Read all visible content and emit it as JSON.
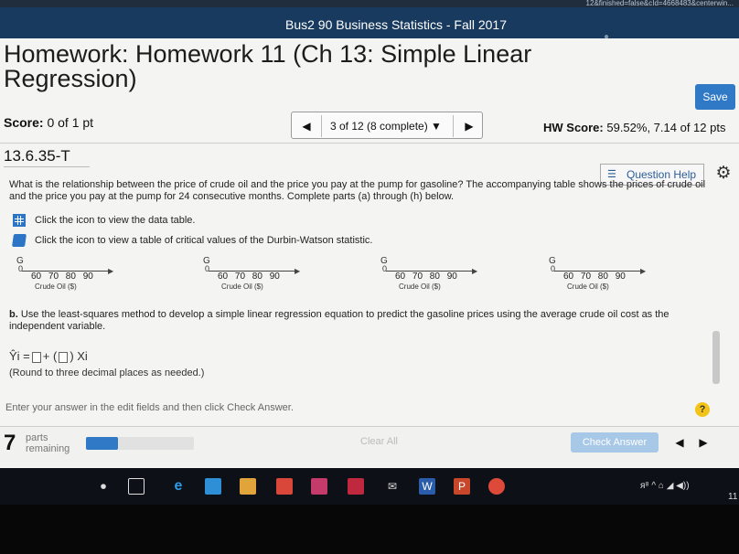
{
  "browser": {
    "url_fragment": "12&finished=false&cId=4668483&centerwin..."
  },
  "header": {
    "course_title": "Bus2 90 Business Statistics - Fall 2017"
  },
  "homework": {
    "title": "Homework: Homework 11 (Ch 13: Simple Linear Regression)",
    "save_label": "Save"
  },
  "score": {
    "label": "Score:",
    "value": "0 of 1 pt"
  },
  "navigation": {
    "prev_label": "◀",
    "status": "3 of 12 (8 complete) ▼",
    "next_label": "▶"
  },
  "hw_score": {
    "label": "HW Score:",
    "value": "59.52%, 7.14 of 12 pts"
  },
  "question": {
    "id": "13.6.35-T",
    "help_label": "Question Help",
    "text": "What is the relationship between the price of crude oil and the price you pay at the pump for gasoline? The accompanying table shows the prices of crude oil and the price you pay at the pump for 24 consecutive months. Complete parts (a) through (h) below.",
    "data_link": "Click the icon to view the data table.",
    "dw_link": "Click the icon to view a table of critical values of the Durbin-Watson statistic."
  },
  "plots": [
    {
      "y_label": "G",
      "zero": "0",
      "ticks": "60 70 80 90",
      "x_label": "Crude Oil ($)"
    },
    {
      "y_label": "G",
      "zero": "0",
      "ticks": "60 70 80 90",
      "x_label": "Crude Oil ($)"
    },
    {
      "y_label": "G",
      "zero": "0",
      "ticks": "60 70 80 90",
      "x_label": "Crude Oil ($)"
    },
    {
      "y_label": "G",
      "zero": "0",
      "ticks": "60 70 80 90",
      "x_label": "Crude Oil ($)"
    }
  ],
  "part_b": {
    "label": "b.",
    "text": "Use the least-squares method to develop a simple linear regression equation to predict the gasoline prices using the average crude oil cost as the independent variable.",
    "equation_lhs": "Ŷi =",
    "equation_mid": "+ (",
    "equation_end": ") Xi",
    "round_note": "(Round to three decimal places as needed.)"
  },
  "footer": {
    "instruction": "Enter your answer in the edit fields and then click Check Answer.",
    "help_symbol": "?",
    "parts_count": "7",
    "parts_text_1": "parts",
    "parts_text_2": "remaining",
    "progress_fraction": 0.3,
    "clear_all": "Clear All",
    "check_answer": "Check Answer",
    "prev": "◀",
    "next": "▶"
  },
  "taskbar": {
    "tray_text": "ᴙ⁸  ^  ⌂  ◢  ◀))",
    "time_fragment": "11"
  },
  "colors": {
    "header_bg": "#173a5e",
    "accent": "#2f79c6",
    "help_yellow": "#f3c317"
  }
}
